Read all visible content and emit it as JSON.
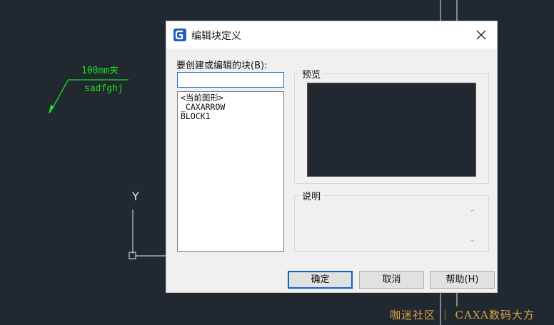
{
  "canvas": {
    "leader_dimension_text": "100mm",
    "leader_suffix_text": "夹",
    "leader_note_text": "sadfghj",
    "axis_y_label": "Y",
    "line_color": "#18e218"
  },
  "dialog": {
    "title": "编辑块定义",
    "name_field_label": "要创建或编辑的块(B):",
    "name_field_value": "",
    "blocks": [
      "<当前图形>",
      "_CAXARROW",
      "BLOCK1"
    ],
    "preview_label": "预览",
    "description_label": "说明",
    "description_value": "",
    "buttons": {
      "ok": "确定",
      "cancel": "取消",
      "help": "帮助(H)"
    },
    "accent_color": "#0a64c8"
  },
  "watermark": "咖迷社区 ｜ CAXA数码大方"
}
